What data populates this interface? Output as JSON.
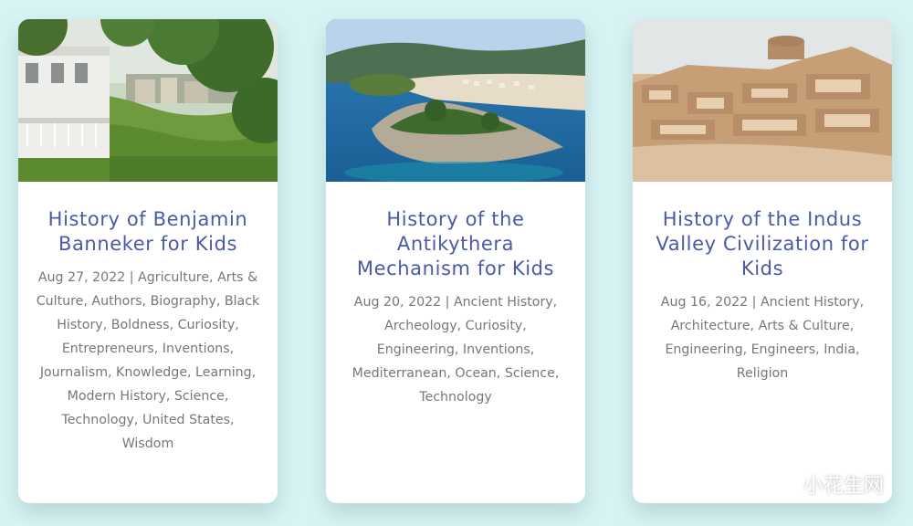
{
  "cards": [
    {
      "title": "History of Benjamin Banneker for Kids",
      "meta": "Aug 27, 2022 | Agriculture, Arts & Culture, Authors, Biography, Black History, Boldness, Curiosity, Entrepreneurs, Inventions, Journalism, Knowledge, Learning, Modern History, Science, Technology, United States, Wisdom"
    },
    {
      "title": "History of the Antikythera Mechanism for Kids",
      "meta": "Aug 20, 2022 | Ancient History, Archeology, Curiosity, Engineering, Inventions, Mediterranean, Ocean, Science, Technology"
    },
    {
      "title": "History of the Indus Valley Civilization for Kids",
      "meta": "Aug 16, 2022 | Ancient History, Architecture, Arts & Culture, Engineering, Engineers, India, Religion"
    }
  ],
  "watermark": {
    "text": "小花生网",
    "icon": "wechat-icon"
  },
  "colors": {
    "background": "#d8f3f3",
    "title": "#4a5aa8",
    "meta": "#777777"
  }
}
